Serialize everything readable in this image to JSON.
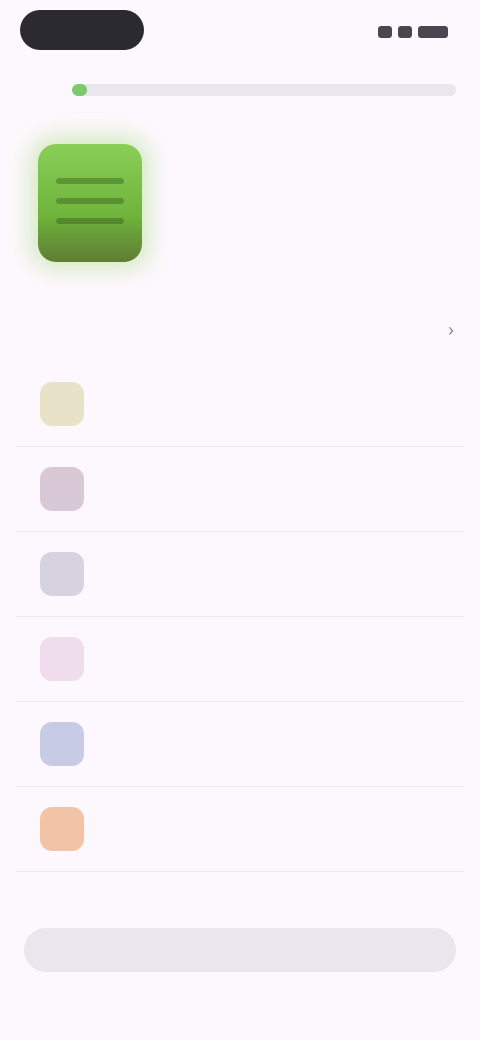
{
  "status_bar": {
    "time": ""
  },
  "install": {
    "progress_fraction": 0.04
  },
  "app": {
    "title": "",
    "subtitle": ""
  },
  "permissions": {
    "section_title": "",
    "items": [
      {
        "label": "",
        "icon": "camera-icon",
        "color": "#e7e2c8"
      },
      {
        "label": "",
        "icon": "contacts-icon",
        "color": "#d9c9d6"
      },
      {
        "label": "",
        "icon": "location-icon",
        "color": "#d6d2df"
      },
      {
        "label": "",
        "icon": "microphone-icon",
        "color": "#efdcec"
      },
      {
        "label": "",
        "icon": "phone-icon",
        "color": "#c8cbe6"
      },
      {
        "label": "",
        "icon": "storage-icon",
        "color": "#f2c3a4"
      }
    ]
  },
  "footer": {
    "label": "",
    "button_label": ""
  }
}
